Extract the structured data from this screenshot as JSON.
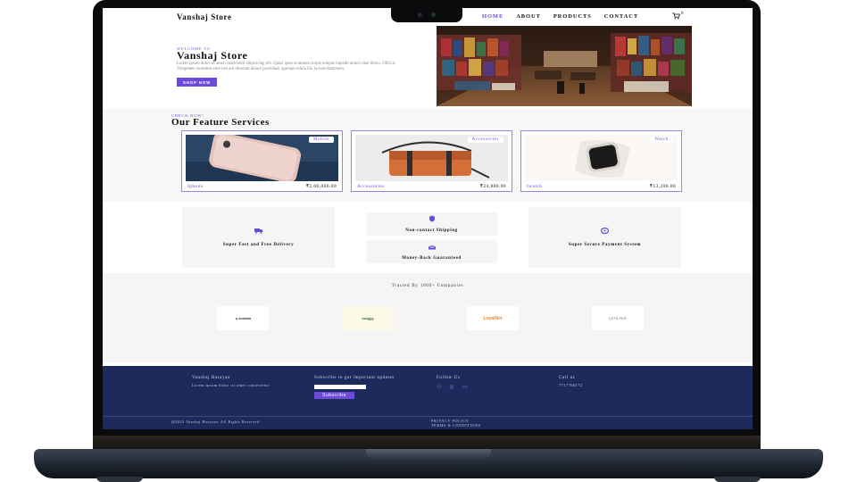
{
  "nav": {
    "brand": "Vanshaj Store",
    "links": [
      "HOME",
      "ABOUT",
      "PRODUCTS",
      "CONTACT"
    ],
    "active": "HOME",
    "cart_count": "0"
  },
  "hero": {
    "eyebrow": "WELCOME TO",
    "title": "Vanshaj Store",
    "text": "Lorem ipsum dolor sit amet consectetur adipisicing elit. Quasi quos ut ameten turpis tempus impedit animi vitae libero. Officiis Voluptates molestias eum nisi aut deserunt dolore providunt, aperiam nihila illo la exercitationem.",
    "button": "SHOP NOW"
  },
  "features": {
    "eyebrow": "CHECK NOW!",
    "title": "Our Feature Services",
    "cards": [
      {
        "tag": "Mobile",
        "name": "Iphone",
        "price": "₹2,00,000.00"
      },
      {
        "tag": "Accessories",
        "name": "Accessories",
        "price": "₹24,800.00"
      },
      {
        "tag": "Watch",
        "name": "Iwatch",
        "price": "₹13,200.00"
      }
    ]
  },
  "services": [
    {
      "label": "Super Fast and Free Delivery",
      "icon": "truck-icon"
    },
    {
      "label": "Non-contact Shipping",
      "icon": "shield-icon"
    },
    {
      "label": "Money-Back Guaranteed",
      "icon": "money-icon"
    },
    {
      "label": "Super Secure Payment System",
      "icon": "payment-icon"
    }
  ],
  "trusted": {
    "title": "Trusted By 1000+ Companies",
    "logos": [
      "zomato",
      "swiggy",
      "LoyalNet",
      "LOTILFER"
    ]
  },
  "footer": {
    "name": "Vanshaj Harayan",
    "about": "Lorem ipsum dolor sit amet consectetur",
    "subscribe_title": "Subscribe to get important updates",
    "subscribe_button": "Subscribe",
    "follow_title": "Follow Us",
    "call_title": "Call us",
    "phone": "7717766172",
    "copyright": "@2023 Vanshaj Harayan. All Rights Reserved",
    "privacy": "PRIVACY POLICY",
    "terms": "TERMS & CONDITIONS"
  },
  "colors": {
    "accent": "#6d4bd9",
    "footer_bg": "#1c2b5c"
  }
}
